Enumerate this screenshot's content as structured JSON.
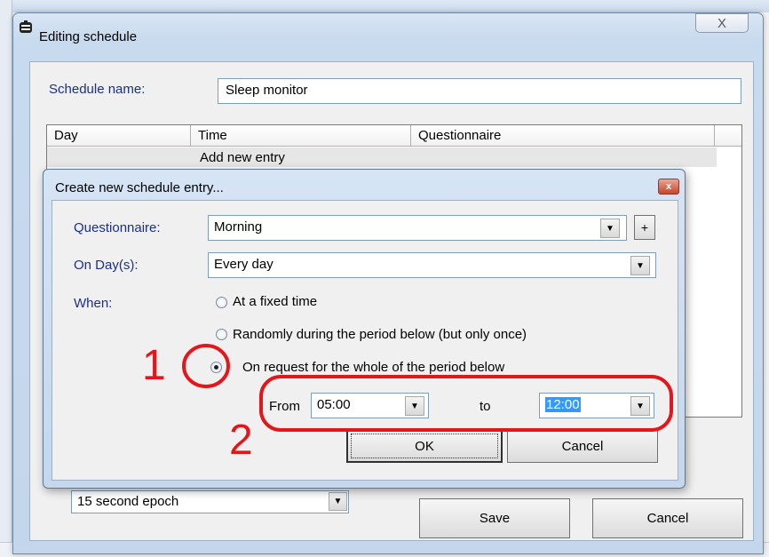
{
  "outer_window": {
    "title": "Editing schedule",
    "close_glyph": "X",
    "schedule_name_label": "Schedule name:",
    "schedule_name_value": "Sleep monitor",
    "list": {
      "columns": [
        "Day",
        "Time",
        "Questionnaire",
        ""
      ],
      "rows": [
        "Add new entry"
      ]
    },
    "epoch_value": "15 second epoch",
    "save_label": "Save",
    "cancel_label": "Cancel"
  },
  "dialog": {
    "title": "Create new schedule entry...",
    "close_glyph": "x",
    "questionnaire_label": "Questionnaire:",
    "questionnaire_value": "Morning",
    "add_button_label": "+",
    "days_label": "On Day(s):",
    "days_value": "Every day",
    "when_label": "When:",
    "radios": [
      {
        "label": "At a fixed time",
        "checked": false
      },
      {
        "label": "Randomly during the period below (but only once)",
        "checked": false
      },
      {
        "label": "On request for the whole of the period below",
        "checked": true
      }
    ],
    "from_label": "From",
    "from_value": "05:00",
    "to_label": "to",
    "to_value": "12:00",
    "ok_label": "OK",
    "cancel_label": "Cancel"
  },
  "annotations": {
    "one": "1",
    "two": "2",
    "color": "#e3161b"
  },
  "icons": {
    "dropdown": "triangle-down",
    "close": "x"
  }
}
